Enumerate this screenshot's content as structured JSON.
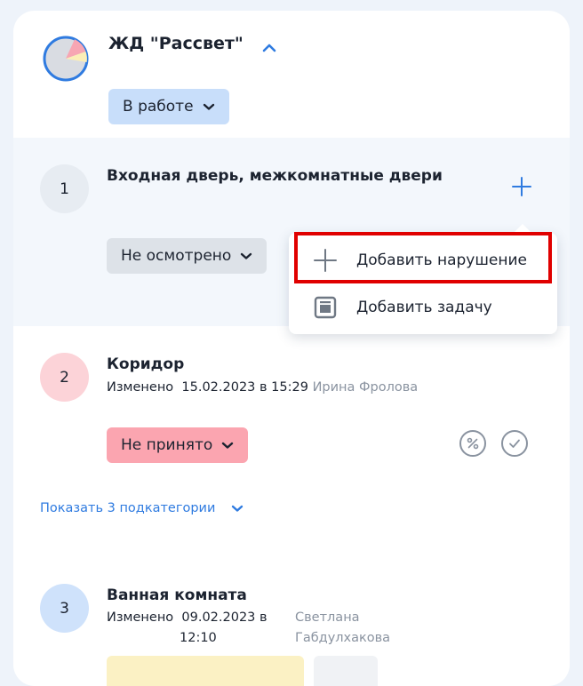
{
  "object": {
    "title": "ЖД \"Рассвет\"",
    "status": "В работе"
  },
  "sections": [
    {
      "number": "1",
      "title": "Входная дверь, межкомнатные двери",
      "status": "Не осмотрено"
    },
    {
      "number": "2",
      "title": "Коридор",
      "changed_label": "Изменено",
      "changed_at": "15.02.2023 в 15:29",
      "author": "Ирина Фролова",
      "status": "Не принято",
      "show_subcategories": "Показать 3 подкатегории"
    },
    {
      "number": "3",
      "title": "Ванная комната",
      "changed_label": "Изменено",
      "changed_date": "09.02.2023 в",
      "changed_time": "12:10",
      "author_first": "Светлана",
      "author_last": "Габдулхакова"
    }
  ],
  "menu": {
    "items": [
      {
        "label": "Добавить нарушение",
        "icon": "plus-icon"
      },
      {
        "label": "Добавить задачу",
        "icon": "task-icon"
      }
    ]
  },
  "colors": {
    "accent": "#2f7be0",
    "status_in_work": "#c8defa",
    "status_not_inspected": "#dde2e8",
    "status_rejected": "#fba5b0",
    "highlight": "#e00000"
  }
}
